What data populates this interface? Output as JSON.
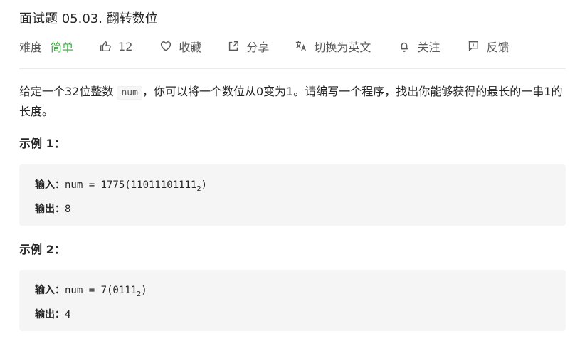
{
  "problem": {
    "title": "面试题 05.03. 翻转数位",
    "difficulty_label": "难度",
    "difficulty_value": "简单",
    "like_count": "12",
    "favorite_label": "收藏",
    "share_label": "分享",
    "switch_lang_label": "切换为英文",
    "follow_label": "关注",
    "feedback_label": "反馈"
  },
  "description": {
    "part1": "给定一个32位整数 ",
    "code": "num",
    "part2": "，你可以将一个数位从0变为1。请编写一个程序，找出你能够获得的最长的一串1的长度。"
  },
  "examples": [
    {
      "title": "示例 1：",
      "input_label": "输入：",
      "input_value": "num = 1775(11011101111",
      "input_sub": "2",
      "input_close": ")",
      "output_label": "输出：",
      "output_value": "8"
    },
    {
      "title": "示例 2：",
      "input_label": "输入：",
      "input_value": "num = 7(0111",
      "input_sub": "2",
      "input_close": ")",
      "output_label": "输出：",
      "output_value": "4"
    }
  ],
  "colors": {
    "easy": "#43a047",
    "text": "#262626",
    "muted": "#595959",
    "example_bg": "#f5f5f5"
  },
  "icons": [
    "thumbs-up-icon",
    "heart-icon",
    "share-icon",
    "translate-icon",
    "bell-icon",
    "feedback-icon"
  ]
}
